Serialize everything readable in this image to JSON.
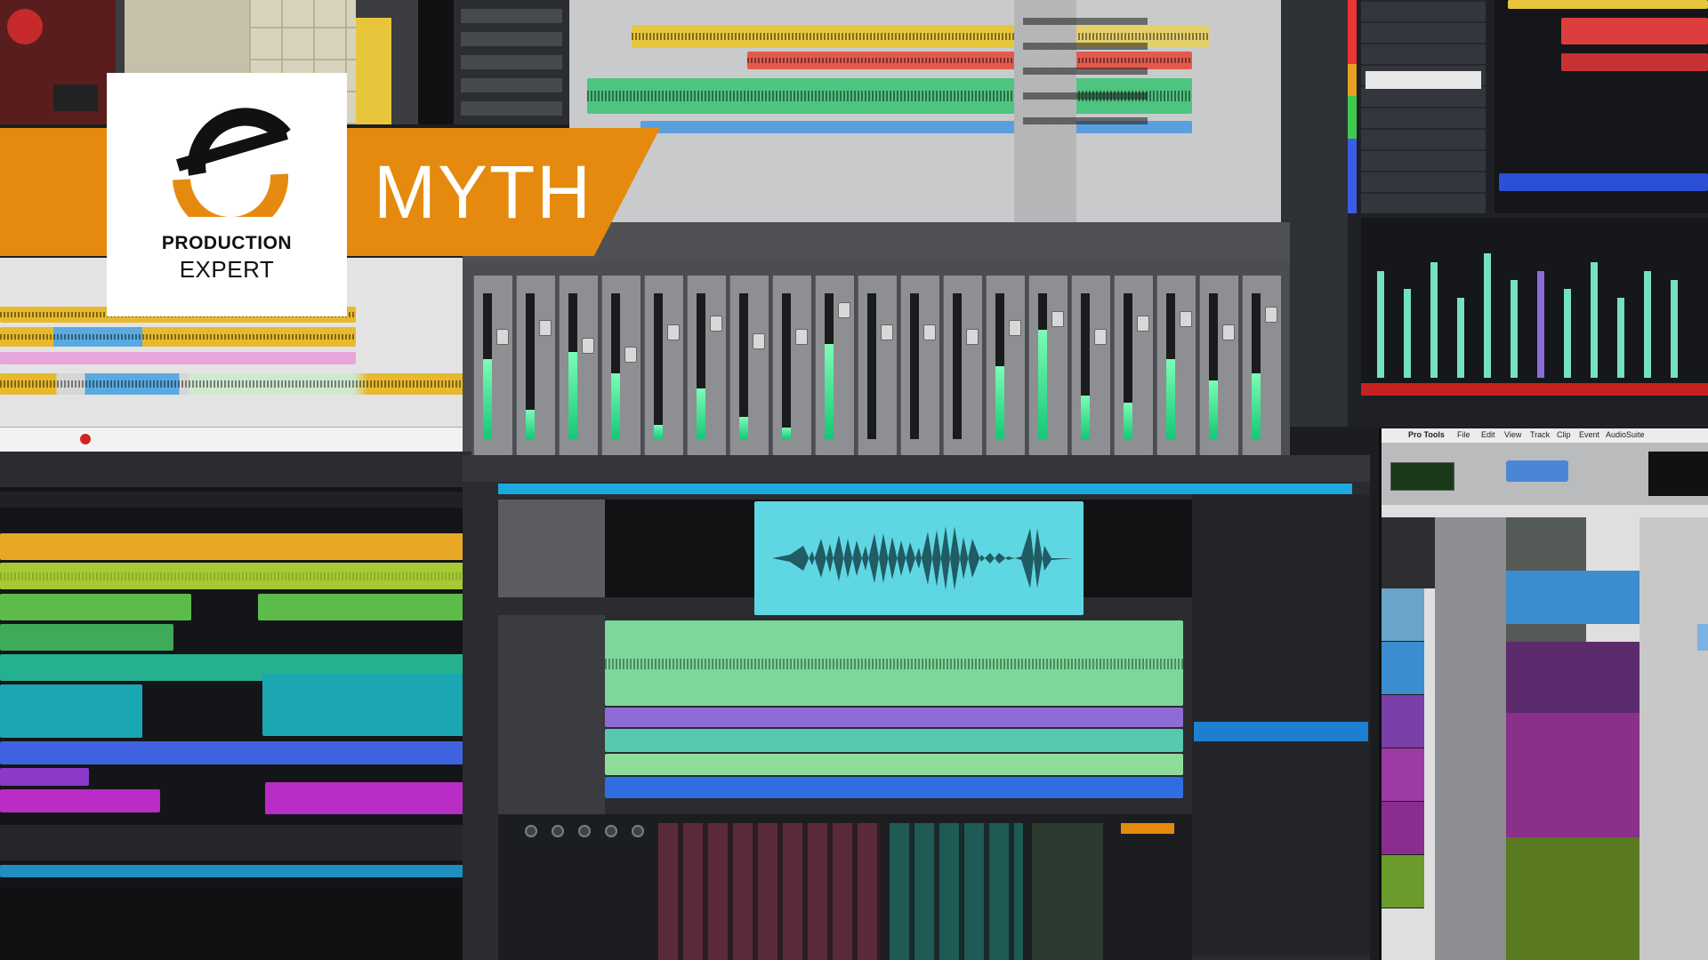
{
  "brand": {
    "name_line1": "PRODUCTION",
    "name_line2": "EXPERT",
    "logo_icon": "production-expert-e-logo"
  },
  "banner": {
    "label": "MYTH",
    "color": "#e58a0e"
  },
  "daw_windows": {
    "pro_tools_menu": [
      "Pro Tools",
      "File",
      "Edit",
      "View",
      "Track",
      "Clip",
      "Event",
      "AudioSuite"
    ]
  },
  "colors": {
    "accent_orange": "#e58a0e",
    "yellow_clip": "#e8c63c",
    "green_clip": "#6fd98a",
    "cyan_clip": "#67d3d3",
    "purple_clip": "#a23bc3",
    "meter_green": "#18d37e"
  }
}
